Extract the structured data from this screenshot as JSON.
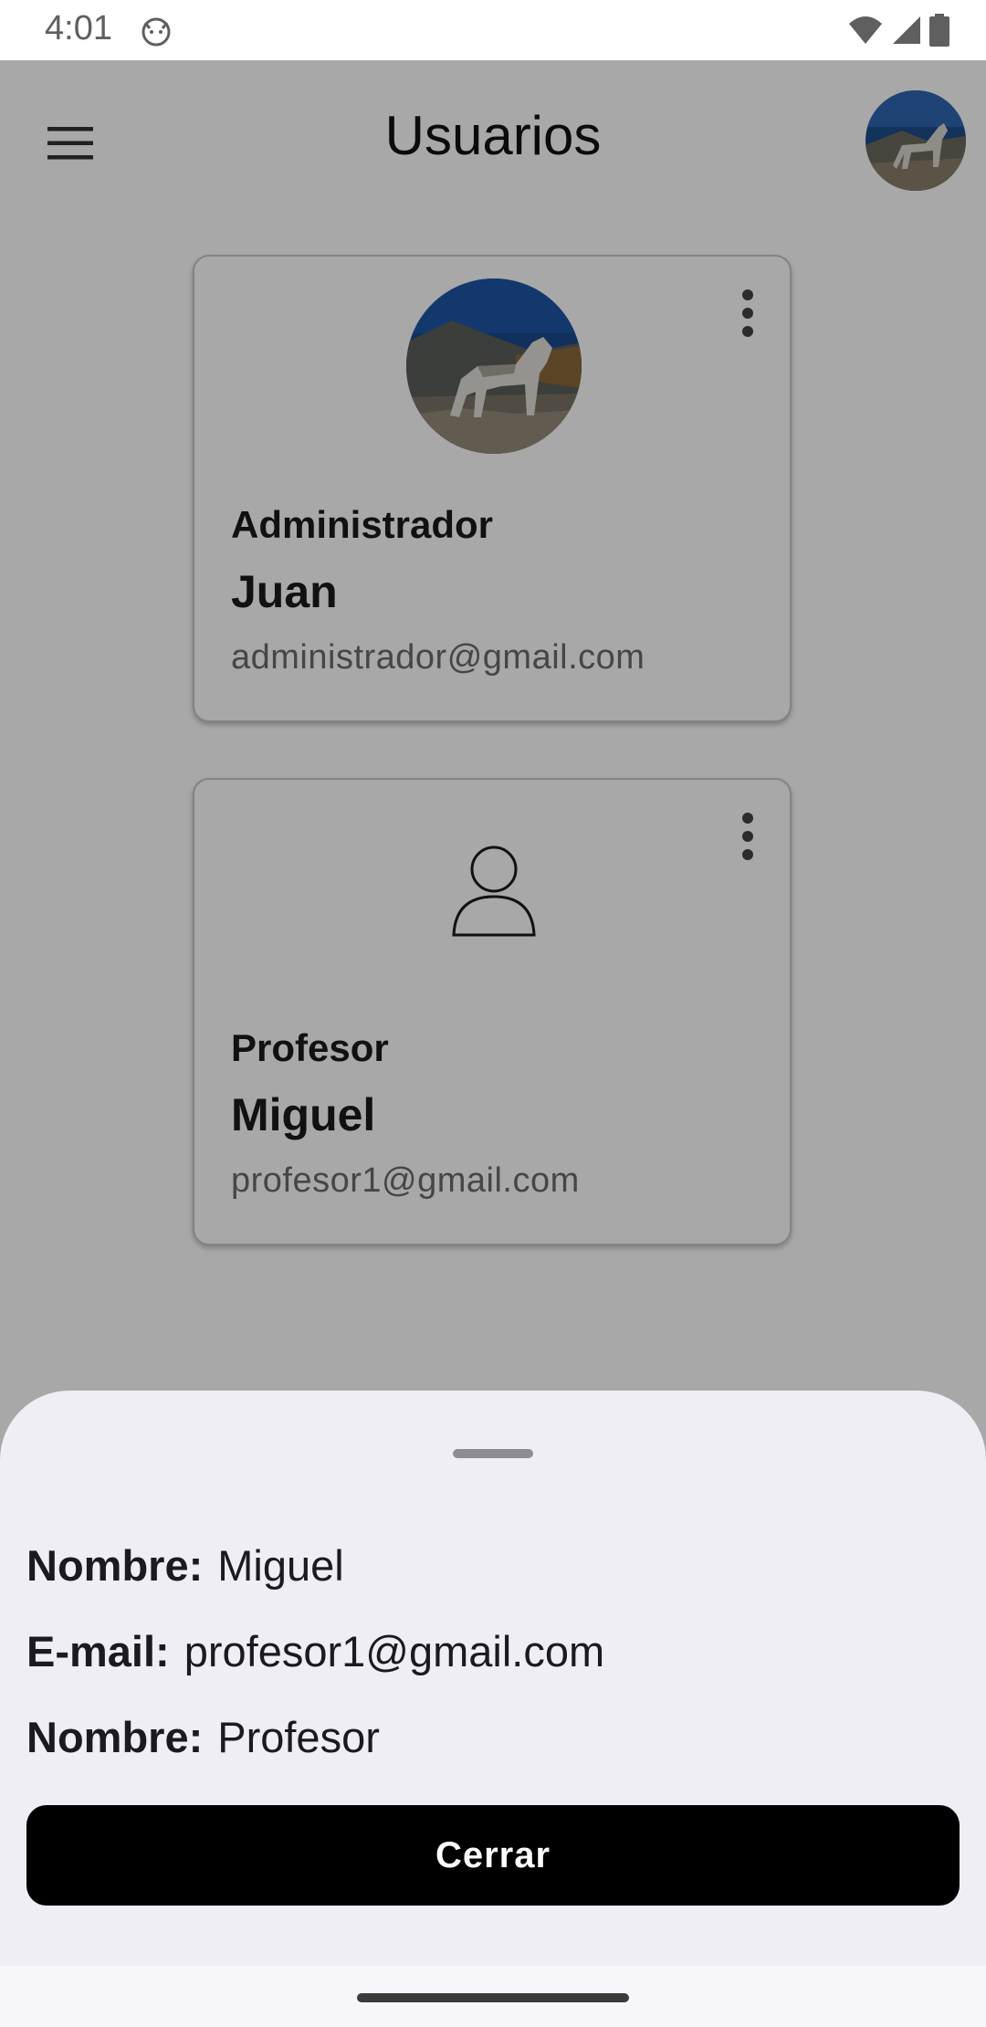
{
  "status_bar": {
    "time": "4:01",
    "app_icon": "cat-face-icon",
    "icons": [
      "wifi-icon",
      "cell-signal-icon",
      "battery-icon"
    ]
  },
  "top_bar": {
    "title": "Usuarios",
    "menu_icon": "hamburger-menu-icon",
    "avatar": "profile-avatar-wolf"
  },
  "users": [
    {
      "role": "Administrador",
      "name": "Juan",
      "email": "administrador@gmail.com",
      "avatar": "wolf-photo"
    },
    {
      "role": "Profesor",
      "name": "Miguel",
      "email": "profesor1@gmail.com",
      "avatar": "person-outline-icon"
    }
  ],
  "bottom_sheet": {
    "name_label": "Nombre:",
    "name_value": "Miguel",
    "email_label": "E-mail:",
    "email_value": "profesor1@gmail.com",
    "role_label": "Nombre:",
    "role_value": "Profesor",
    "close_label": "Cerrar"
  },
  "colors": {
    "scrim": "#000000",
    "button_bg": "#000000",
    "sheet_bg": "#efeef5"
  }
}
